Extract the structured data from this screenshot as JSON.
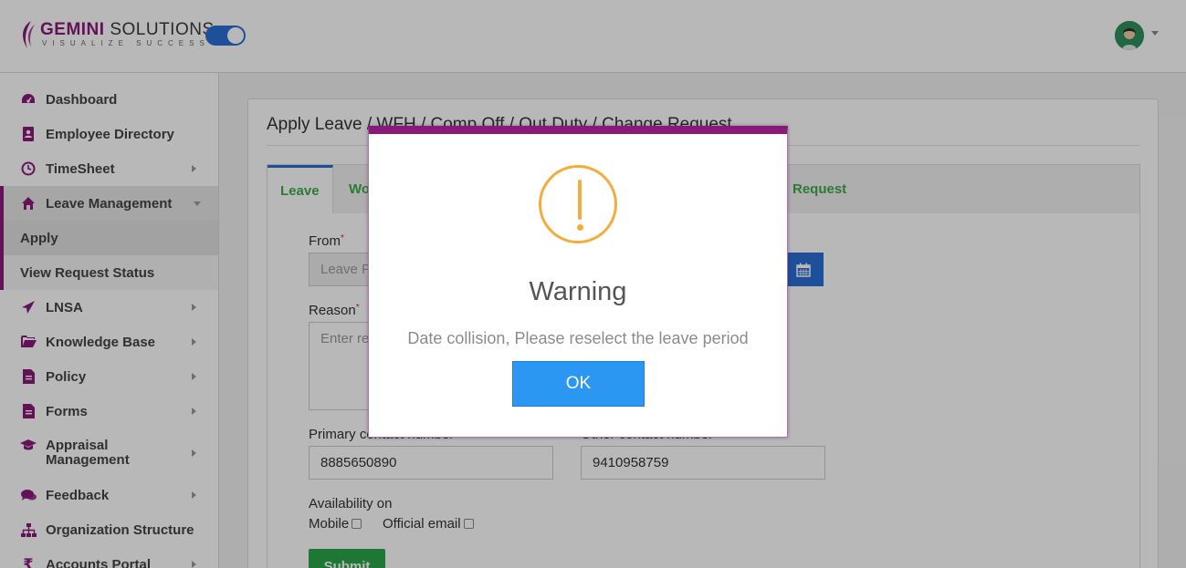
{
  "header": {
    "brand_a": "GEMINI",
    "brand_b": " SOLUTIONS",
    "tagline": "VISUALIZE SUCCESS"
  },
  "sidebar": {
    "items": [
      {
        "label": "Dashboard",
        "icon": "dashboard-icon"
      },
      {
        "label": "Employee Directory",
        "icon": "address-book-icon"
      },
      {
        "label": "TimeSheet",
        "icon": "clock-icon"
      },
      {
        "label": "Leave Management",
        "icon": "home-icon"
      },
      {
        "label": "LNSA",
        "icon": "paper-plane-icon"
      },
      {
        "label": "Knowledge Base",
        "icon": "folder-open-icon"
      },
      {
        "label": "Policy",
        "icon": "document-icon"
      },
      {
        "label": "Forms",
        "icon": "document-icon"
      },
      {
        "label": "Appraisal Management",
        "icon": "graduation-cap-icon"
      },
      {
        "label": "Feedback",
        "icon": "comments-icon"
      },
      {
        "label": "Organization Structure",
        "icon": "sitemap-icon"
      },
      {
        "label": "Accounts Portal",
        "icon": "rupee-icon"
      }
    ],
    "sub_items": [
      {
        "label": "Apply"
      },
      {
        "label": "View Request Status"
      }
    ]
  },
  "main": {
    "title": "Apply Leave / WFH / Comp Off / Out Duty / Change Request",
    "tabs": [
      {
        "label": "Leave"
      },
      {
        "label": "Wo"
      },
      {
        "label": "Request"
      }
    ],
    "form": {
      "from_label": "From",
      "from_placeholder": "Leave P",
      "reason_label": "Reason",
      "reason_placeholder": "Enter re",
      "primary_contact_label": "Primary contact number",
      "primary_contact_value": "8885650890",
      "other_contact_label": "Other contact number",
      "other_contact_value": "9410958759",
      "availability_label": "Availability on",
      "mobile_label": "Mobile",
      "email_label": "Official email",
      "submit_label": "Submit",
      "required_mark": "*"
    }
  },
  "modal": {
    "title": "Warning",
    "message": "Date collision, Please reselect the leave period",
    "ok_label": "OK",
    "icon": "warning-icon"
  },
  "colors": {
    "brand_purple": "#8a1a7a",
    "accent_blue": "#2a6fd4",
    "ok_blue": "#2c96f3",
    "warning_orange": "#f6ac3b",
    "tab_green": "#3eaa4c",
    "submit_green": "#2ca64a"
  }
}
